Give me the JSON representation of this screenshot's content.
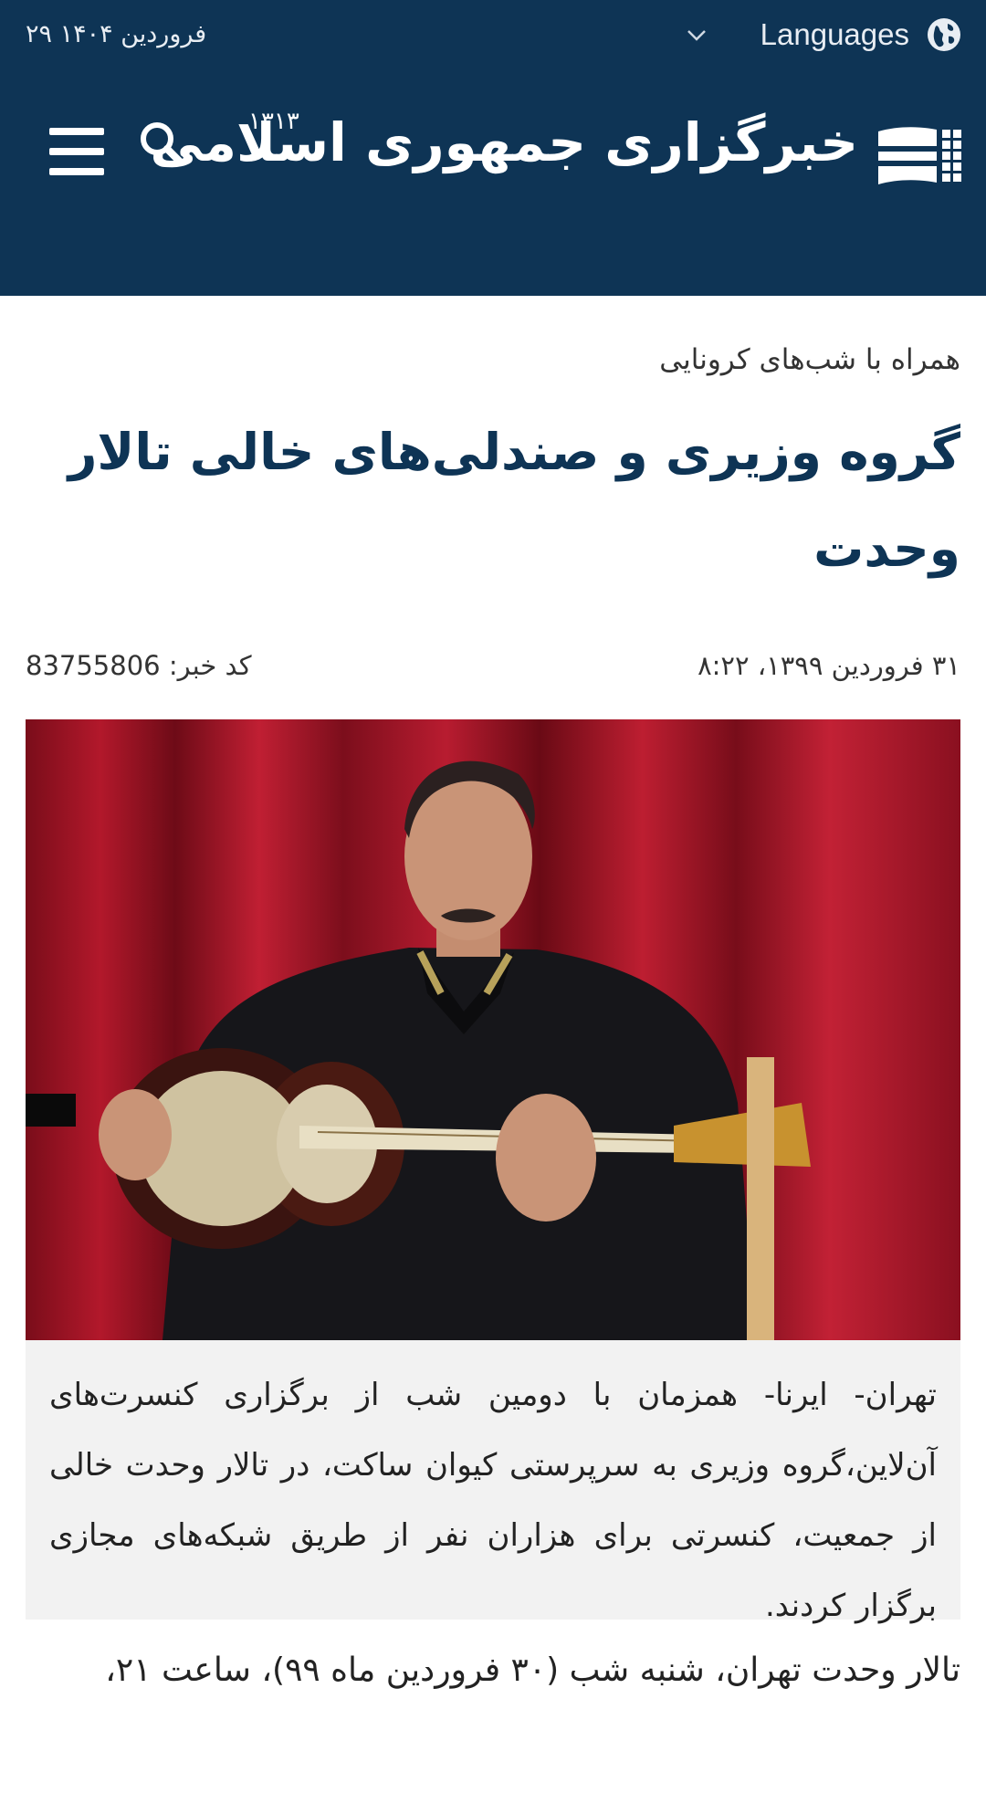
{
  "header": {
    "date": "۲۹ فروردین ۱۴۰۴",
    "languages_label": "Languages",
    "logo_text": "خبرگزاری جمهوری اسلامی",
    "logo_year": "۱۳۱۳",
    "colors": {
      "background": "#0e3455",
      "text": "#ffffff"
    }
  },
  "article": {
    "subtitle": "همراه با شب‌های کرونایی",
    "title": "گروه وزیری و صندلی‌های خالی تالار وحدت",
    "published": "۳۱ فروردین ۱۳۹۹، ۸:۲۲",
    "code_label": "کد خبر:",
    "code_value": "83755806",
    "lead": "تهران- ایرنا- همزمان با دومین شب از برگزاری کنسرت‌های آن‌لاین،گروه وزیری به سرپرستی کیوان ساکت، در تالار وحدت خالی از جمعیت، کنسرتی برای هزاران نفر از طریق شبکه‌های مجازی برگزار کردند.",
    "body_start": "تالار وحدت تهران، شنبه شب (۳۰ فروردین ماه ۹۹)، ساعت ۲۱،"
  }
}
